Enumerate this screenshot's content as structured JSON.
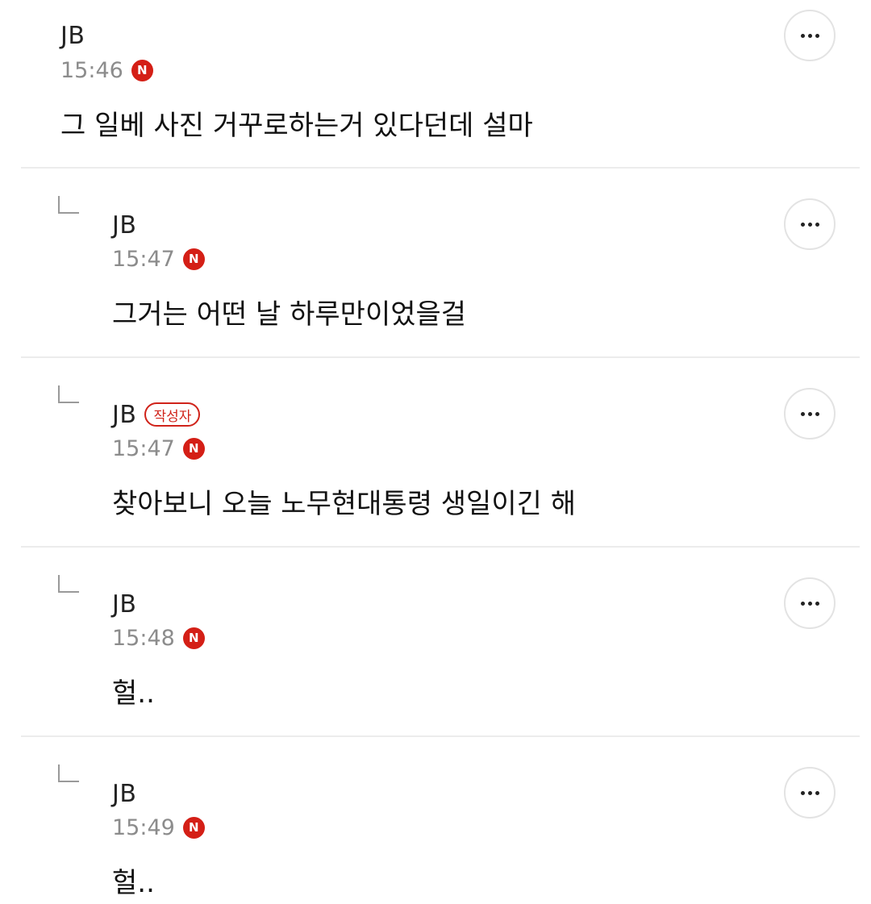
{
  "comments": [
    {
      "author": "JB",
      "time": "15:46",
      "new_badge": "N",
      "text": "그 일베 사진 거꾸로하는거 있다던데 설마",
      "is_reply": false,
      "writer_badge": ""
    },
    {
      "author": "JB",
      "time": "15:47",
      "new_badge": "N",
      "text": "그거는 어떤 날 하루만이었을걸",
      "is_reply": true,
      "writer_badge": ""
    },
    {
      "author": "JB",
      "time": "15:47",
      "new_badge": "N",
      "text": "찾아보니 오늘 노무현대통령 생일이긴 해",
      "is_reply": true,
      "writer_badge": "작성자"
    },
    {
      "author": "JB",
      "time": "15:48",
      "new_badge": "N",
      "text": "헐..",
      "is_reply": true,
      "writer_badge": ""
    },
    {
      "author": "JB",
      "time": "15:49",
      "new_badge": "N",
      "text": "헐..",
      "is_reply": true,
      "writer_badge": ""
    }
  ],
  "colors": {
    "badge_red": "#d41f16",
    "divider": "#ececec",
    "time_gray": "#8c8c8c"
  },
  "icons": {
    "more": "more-options-icon",
    "reply": "reply-arrow-icon"
  }
}
